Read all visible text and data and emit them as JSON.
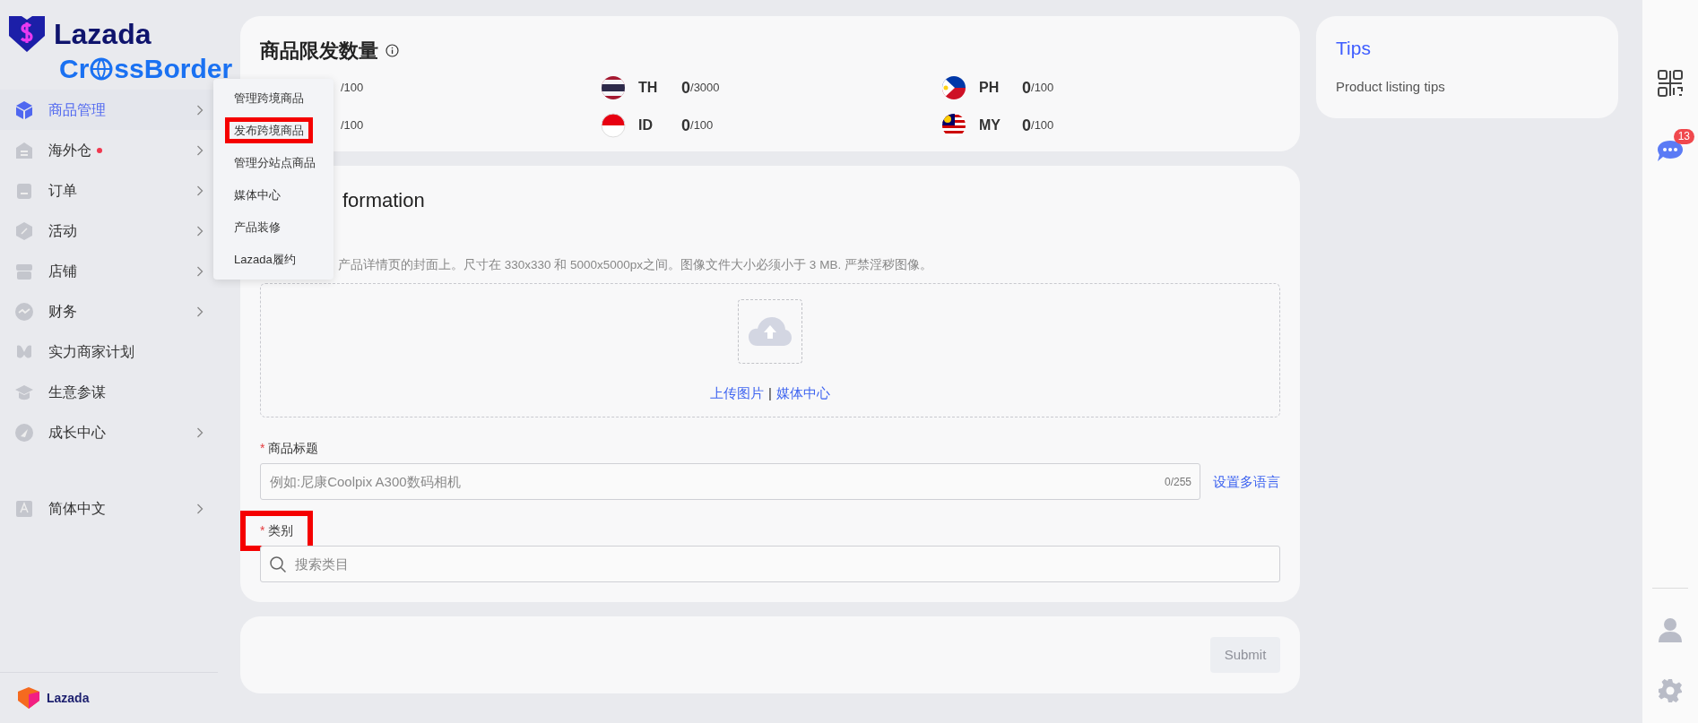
{
  "brand": {
    "name": "Lazada",
    "subtitle_before": "Cr",
    "subtitle_after": "ssBorder"
  },
  "sidebar": {
    "items": [
      {
        "label": "商品管理",
        "selected": true,
        "expandable": true,
        "dot": false
      },
      {
        "label": "海外仓",
        "selected": false,
        "expandable": true,
        "dot": true
      },
      {
        "label": "订单",
        "selected": false,
        "expandable": true,
        "dot": false
      },
      {
        "label": "活动",
        "selected": false,
        "expandable": true,
        "dot": false
      },
      {
        "label": "店铺",
        "selected": false,
        "expandable": true,
        "dot": false
      },
      {
        "label": "财务",
        "selected": false,
        "expandable": true,
        "dot": false
      },
      {
        "label": "实力商家计划",
        "selected": false,
        "expandable": false,
        "dot": false
      },
      {
        "label": "生意参谋",
        "selected": false,
        "expandable": false,
        "dot": false
      },
      {
        "label": "成长中心",
        "selected": false,
        "expandable": true,
        "dot": false
      }
    ],
    "language": {
      "label": "简体中文",
      "expandable": true
    },
    "footer_brand": "Lazada"
  },
  "flyout": {
    "items": [
      {
        "label": "管理跨境商品",
        "highlighted": false
      },
      {
        "label": "发布跨境商品",
        "highlighted": true
      },
      {
        "label": "管理分站点商品",
        "highlighted": false
      },
      {
        "label": "媒体中心",
        "highlighted": false
      },
      {
        "label": "产品装修",
        "highlighted": false
      },
      {
        "label": "Lazada履约",
        "highlighted": false
      }
    ]
  },
  "quota": {
    "title": "商品限发数量",
    "items": [
      {
        "limit": "/100"
      },
      {
        "code": "TH",
        "count": "0",
        "limit": "/3000"
      },
      {
        "code": "PH",
        "count": "0",
        "limit": "/100"
      },
      {
        "limit": "/100"
      },
      {
        "code": "ID",
        "count": "0",
        "limit": "/100"
      },
      {
        "code": "MY",
        "count": "0",
        "limit": "/100"
      }
    ]
  },
  "info_card": {
    "title": "formation",
    "hint": "产品详情页的封面上。尺寸在 330x330 和 5000x5000px之间。图像文件大小必须小于 3 MB. 严禁淫秽图像。",
    "upload": {
      "upload_link": "上传图片",
      "separator": "|",
      "media_link": "媒体中心"
    },
    "fields": [
      {
        "kind": "text",
        "label": "商品标题",
        "required_mark": "*",
        "highlighted": false,
        "placeholder": "例如:尼康Coolpix A300数码相机",
        "counter": "0/255",
        "action": "设置多语言"
      },
      {
        "kind": "search",
        "label": "类别",
        "required_mark": "*",
        "highlighted": true,
        "placeholder": "搜索类目"
      }
    ]
  },
  "submit": {
    "label": "Submit",
    "disabled": true
  },
  "tips": {
    "title": "Tips",
    "text": "Product listing tips"
  },
  "rail": {
    "chat_badge": "13"
  }
}
